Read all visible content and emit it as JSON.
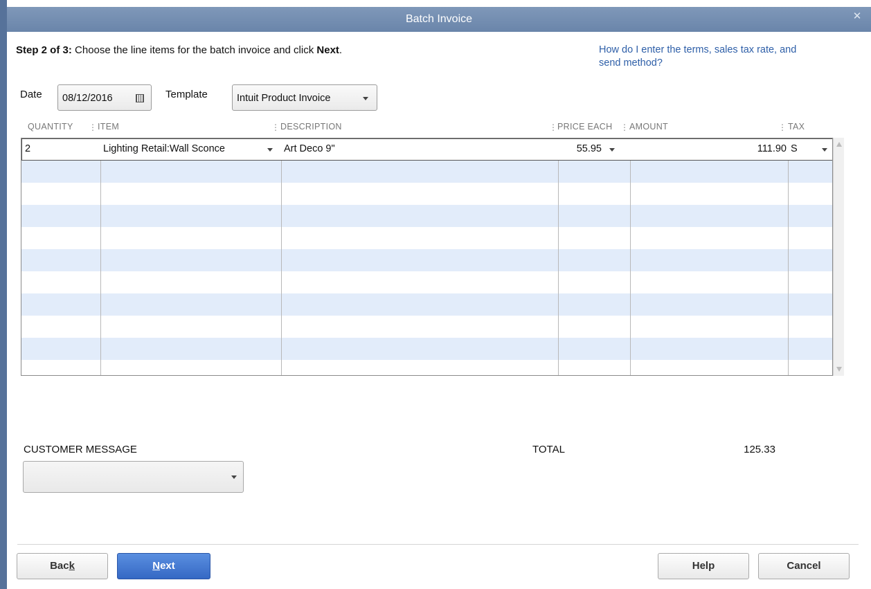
{
  "window": {
    "title": "Batch Invoice"
  },
  "step": {
    "prefix": "Step 2 of 3:",
    "text": " Choose the line items for the batch invoice and click ",
    "action": "Next",
    "suffix": "."
  },
  "help_link": {
    "text": "How do I enter the terms, sales tax rate, and send method?"
  },
  "form": {
    "date_label": "Date",
    "date_value": "08/12/2016",
    "template_label": "Template",
    "template_value": "Intuit Product Invoice"
  },
  "table": {
    "columns": [
      "QUANTITY",
      "ITEM",
      "DESCRIPTION",
      "PRICE EACH",
      "AMOUNT",
      "TAX"
    ],
    "rows": [
      {
        "quantity": "2",
        "item": "Lighting Retail:Wall Sconce",
        "description": "Art Deco 9\"",
        "price_each": "55.95",
        "amount": "111.90",
        "tax": "S"
      }
    ]
  },
  "customer_message": {
    "label": "CUSTOMER MESSAGE",
    "value": ""
  },
  "total": {
    "label": "TOTAL",
    "value": "125.33"
  },
  "buttons": {
    "back": {
      "pre": "Bac",
      "ul": "k",
      "post": ""
    },
    "next": {
      "pre": "",
      "ul": "N",
      "post": "ext"
    },
    "help": "Help",
    "cancel": "Cancel"
  },
  "colors": {
    "title_bar": "#6a85aa",
    "row_alt": "#e2ecfa",
    "link": "#2e5fa8",
    "primary_button": "#3568c4"
  },
  "icons": {
    "close": "close-icon",
    "calendar": "calendar-icon",
    "dropdown": "chevron-down-icon"
  }
}
